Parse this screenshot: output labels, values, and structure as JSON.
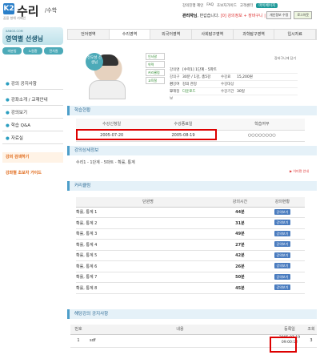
{
  "header": {
    "logo_mark": "K2",
    "logo_title": "수리",
    "logo_sub": "/수학",
    "logo_tag": "꿈을 향해 카페인",
    "top_links": [
      "강의진행 혜인",
      "FAQ",
      "초보자가이드",
      "고객센터"
    ],
    "top_btn": "마이페이지",
    "greeting_name": "관리자님",
    "greeting_rest": ", 반갑습니다.",
    "greeting_count": "[0] 강의정보 + 장바구니 | 강의신청서",
    "top_buttons": [
      "개인정보 수정",
      "로그아웃"
    ]
  },
  "sidebar": {
    "teacher_small": "XANGS.COM",
    "teacher_name": "영역별 선생님",
    "tabs": [
      "미분법",
      "노원환",
      "전치원"
    ],
    "menu": [
      "강의 공지사항",
      "강좌소개 / 교재안내",
      "강의보기",
      "학습 Q&A",
      "자료실"
    ],
    "banner1": "강의 검색하기",
    "banner2": "강좌별 초보자 가이드"
  },
  "nav": {
    "items": [
      "언어영역",
      "수리영역",
      "외국어영역",
      "사회탐구영역",
      "과학탐구영역",
      "입시자료"
    ]
  },
  "profile": {
    "bubble": "전오성 선생님",
    "menu": [
      "인사말",
      "약력",
      "커리큘럼",
      "교육철"
    ],
    "crumb": "장바구니에 담기",
    "info": [
      [
        "강의명",
        "[수학1] 1단계 - 5파트",
        "",
        ""
      ],
      [
        "강의구성",
        "30분 / 1강, 총5강",
        "수강료",
        "15,200원"
      ],
      [
        "관강여부",
        "강의 관강",
        "수강대상",
        ""
      ],
      [
        "교재정보",
        "다운로드",
        "수강기간",
        "30일"
      ]
    ]
  },
  "sections": {
    "status": "학습현황",
    "detail": "강의상세정보",
    "curriculum": "커리큘럼",
    "notice": "해당강의 공지사항"
  },
  "status_table": {
    "headers": [
      "수강신청일",
      "수강종료일",
      "학습여부"
    ],
    "row": [
      "2005-07-20",
      "2005-08-19",
      "○○○○○○○○"
    ]
  },
  "detail": {
    "path": "수리1 - 1단계 - 5파트 - 확률, 통계",
    "link": "▶ 이미편 안내"
  },
  "curriculum": {
    "headers": [
      "단원명",
      "강의시간",
      "강의현황"
    ],
    "rows": [
      [
        "확률, 통계 1",
        "44분",
        "강의보기"
      ],
      [
        "확률, 통계 2",
        "31분",
        "강의보기"
      ],
      [
        "확률, 통계 3",
        "49분",
        "강의보기"
      ],
      [
        "확률, 통계 4",
        "27분",
        "강의보기"
      ],
      [
        "확률, 통계 5",
        "42분",
        "강의보기"
      ],
      [
        "확률, 통계 6",
        "26분",
        "강의보기"
      ],
      [
        "확률, 통계 7",
        "50분",
        "강의보기"
      ],
      [
        "확률, 통계 8",
        "45분",
        "강의보기"
      ]
    ]
  },
  "notice": {
    "headers": [
      "번호",
      "내용",
      "등록일",
      "조회"
    ],
    "row": [
      "1",
      "sdf",
      "2005-07-19 09:00:12",
      "3"
    ]
  }
}
